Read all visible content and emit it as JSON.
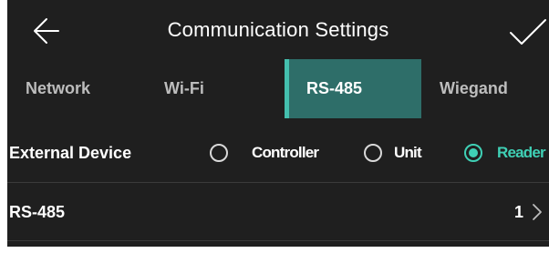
{
  "header": {
    "title": "Communication Settings",
    "back_icon": "arrow-left-icon",
    "confirm_icon": "checkmark-icon"
  },
  "tabs": [
    {
      "label": "Network",
      "active": false
    },
    {
      "label": "Wi-Fi",
      "active": false
    },
    {
      "label": "RS-485",
      "active": true
    },
    {
      "label": "Wiegand",
      "active": false
    }
  ],
  "external_device": {
    "label": "External Device",
    "options": [
      {
        "label": "Controller",
        "selected": false
      },
      {
        "label": "Unit",
        "selected": false
      },
      {
        "label": "Reader",
        "selected": true
      }
    ]
  },
  "rs485_row": {
    "label": "RS-485",
    "value": "1",
    "icon": "chevron-right-icon"
  },
  "colors": {
    "background": "#1f1f1f",
    "accent": "#3fd0b5",
    "active_tab_bg": "#2e6e69",
    "active_tab_bar": "#44bfae",
    "inactive_text": "#bdbdbd"
  }
}
